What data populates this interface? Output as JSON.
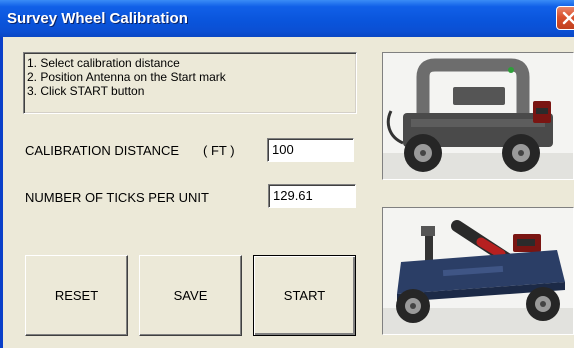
{
  "window": {
    "title": "Survey Wheel Calibration",
    "titlebar_color": "#0a55dc",
    "close_icon": "close-icon"
  },
  "instructions": {
    "lines": [
      "1. Select calibration distance",
      "2. Position Antenna on the Start mark",
      "3. Click START button"
    ]
  },
  "fields": {
    "calibration_distance": {
      "label": "CALIBRATION DISTANCE",
      "unit": "( FT )",
      "value": "100"
    },
    "ticks_per_unit": {
      "label": "NUMBER OF TICKS PER UNIT",
      "value": "129.61"
    }
  },
  "buttons": {
    "reset": "RESET",
    "save": "SAVE",
    "start": "START"
  },
  "images": {
    "top": "survey-wheel-cart-photo",
    "bottom": "antenna-cart-with-handle-photo"
  }
}
